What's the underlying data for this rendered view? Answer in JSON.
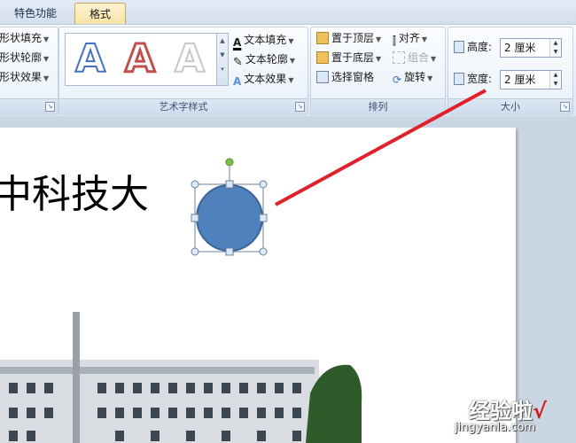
{
  "tabs": [
    {
      "label": "特色功能"
    },
    {
      "label": "格式"
    }
  ],
  "shape_group": {
    "items": [
      "形状填充",
      "形状轮廓",
      "形状效果"
    ]
  },
  "art_group": {
    "label": "艺术字样式",
    "gallery": [
      "A",
      "A",
      "A"
    ],
    "text_fill": "文本填充",
    "text_outline": "文本轮廓",
    "text_effect": "文本效果"
  },
  "arrange_group": {
    "label": "排列",
    "bring_front": "置于顶层",
    "send_back": "置于底层",
    "selection_pane": "选择窗格",
    "align": "对齐",
    "group": "组合",
    "rotate": "旋转"
  },
  "size_group": {
    "label": "大小",
    "height_label": "高度:",
    "height_value": "2 厘米",
    "width_label": "宽度:",
    "width_value": "2 厘米"
  },
  "slide": {
    "title_text": "中科技大"
  },
  "watermark": {
    "line1": "经验啦",
    "check": "√",
    "line2": "jingyanla.com"
  },
  "colors": {
    "circle_fill": "#4f81bd",
    "annotation_line": "#e0202a",
    "rotate_handle": "#7ac143"
  }
}
